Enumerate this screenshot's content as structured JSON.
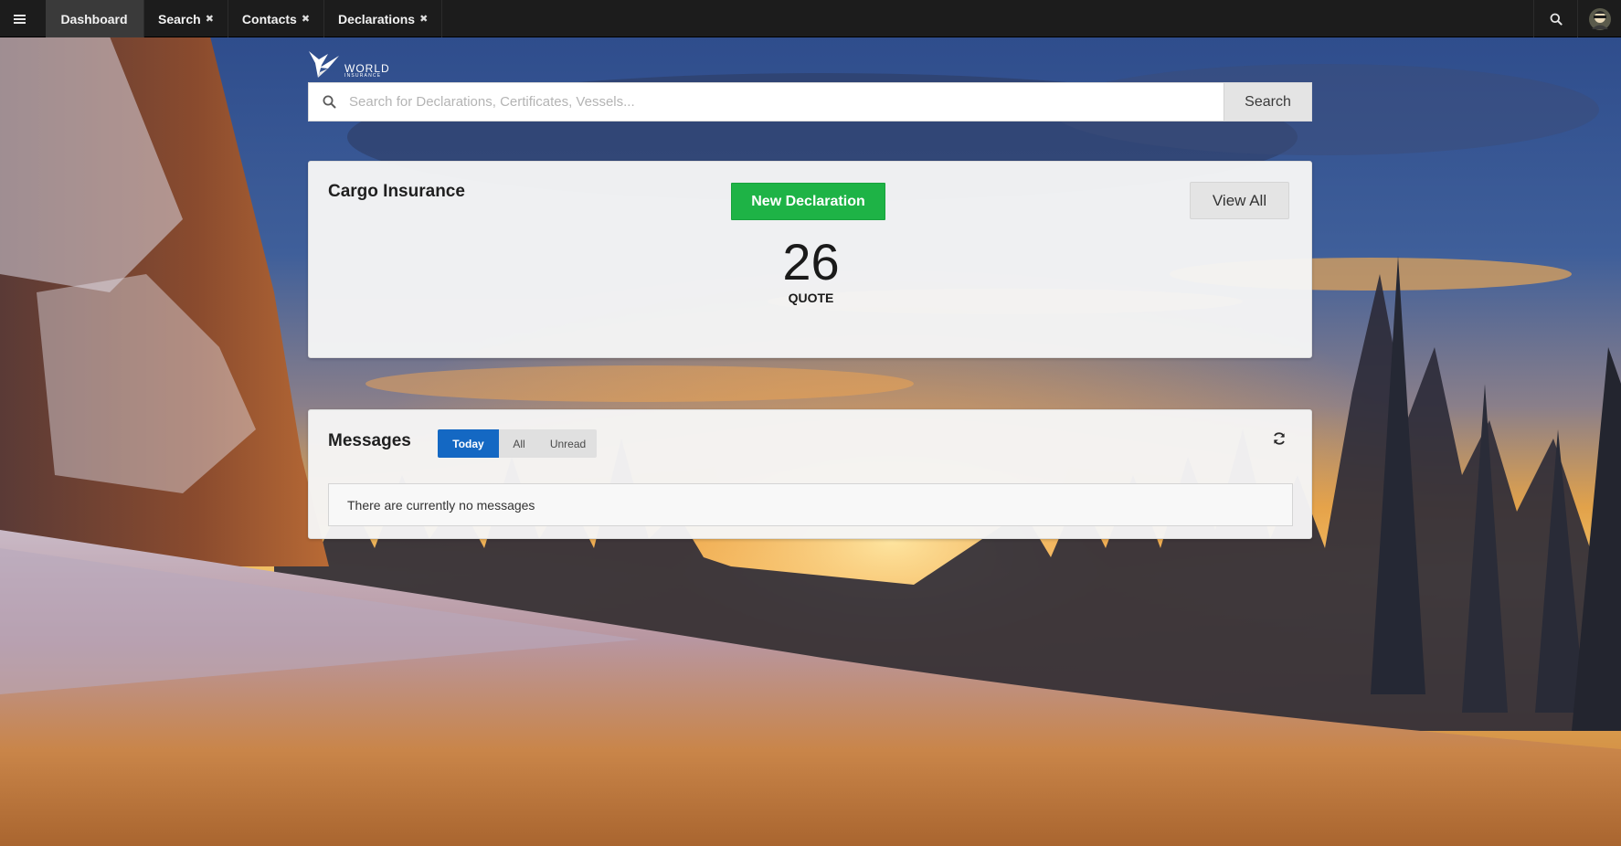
{
  "nav": {
    "tabs": [
      {
        "label": "Dashboard",
        "closable": false,
        "active": true
      },
      {
        "label": "Search",
        "closable": true,
        "active": false
      },
      {
        "label": "Contacts",
        "closable": true,
        "active": false
      },
      {
        "label": "Declarations",
        "closable": true,
        "active": false
      }
    ],
    "close_glyph": "✖",
    "icons": [
      "hamburger-menu-icon",
      "search-icon",
      "user-avatar"
    ]
  },
  "logo": {
    "word": "WORLD",
    "sub": "INSURANCE"
  },
  "search": {
    "placeholder": "Search for Declarations, Certificates, Vessels...",
    "value": "",
    "button_label": "Search"
  },
  "cargo": {
    "title": "Cargo Insurance",
    "new_button_label": "New Declaration",
    "view_all_label": "View All",
    "count": "26",
    "count_label": "QUOTE"
  },
  "messages": {
    "title": "Messages",
    "filters": [
      {
        "label": "Today",
        "active": true
      },
      {
        "label": "All",
        "active": false
      },
      {
        "label": "Unread",
        "active": false
      }
    ],
    "empty_text": "There are currently no messages"
  },
  "colors": {
    "topbar": "#1c1c1c",
    "active_tab": "#3a3a3a",
    "primary_green": "#1eb346",
    "filter_blue": "#1468c3"
  }
}
